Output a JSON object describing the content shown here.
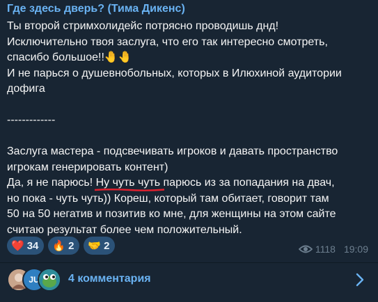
{
  "post": {
    "author": "Где здесь дверь? (Тима Дикенс)",
    "lines": [
      "Ты второй стримхолидейс потрясно проводишь днд!",
      "Исключительно твоя заслуга, что его так интересно смотреть,",
      "спасибо большое!!",
      "И не парься о душевнобольных, которых в Илюхиной аудитории",
      "дофига",
      "",
      "-------------",
      "",
      "Заслуга мастера - подсвечивать игроков и давать пространство",
      "игрокам генерировать контент)"
    ],
    "emoji_after_line3": "🤚🤚",
    "highlight_line": {
      "before": "Да, я не парюсь! ",
      "highlighted": "Ну чуть чуть парюсь из за попадания на двач",
      "after": ","
    },
    "lines_after": [
      "но пока - чуть чуть)) Кореш, который там обитает, говорит там",
      "50 на 50 негатив и позитив ко мне, для женщины на этом сайте",
      "считаю результат более чем положительный."
    ]
  },
  "reactions": [
    {
      "emoji": "❤️",
      "count": "34"
    },
    {
      "emoji": "🔥",
      "count": "2"
    },
    {
      "emoji": "🤝",
      "count": "2"
    }
  ],
  "meta": {
    "views": "1118",
    "time": "19:09",
    "icon": "eye-icon"
  },
  "comments": {
    "label": "4 комментария",
    "avatar_initials": [
      "",
      "JU",
      ""
    ],
    "icon": "chevron-right-icon"
  },
  "colors": {
    "background": "#182533",
    "accent": "#6ab3f3",
    "reaction_bg": "#2b5278",
    "underline": "#e0202e"
  }
}
